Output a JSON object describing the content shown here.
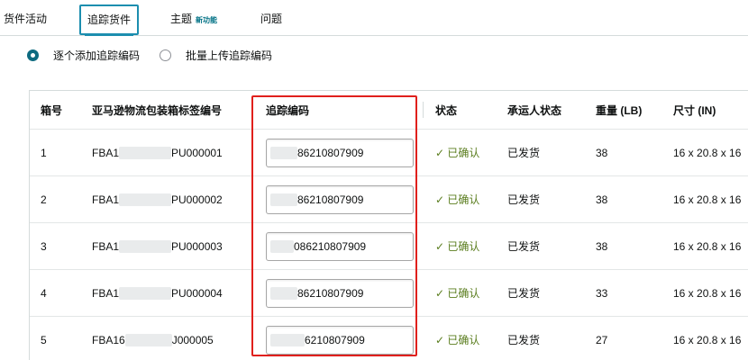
{
  "tabs": [
    {
      "label": "货件活动",
      "badge": ""
    },
    {
      "label": "追踪货件",
      "badge": ""
    },
    {
      "label": "主题",
      "badge": "新功能"
    },
    {
      "label": "问题",
      "badge": ""
    }
  ],
  "active_tab": "追踪货件",
  "upload_mode": {
    "options": [
      "逐个添加追踪编码",
      "批量上传追踪编码"
    ],
    "selected": "逐个添加追踪编码"
  },
  "table": {
    "headers": {
      "box": "箱号",
      "label": "亚马逊物流包装箱标签编号",
      "tracking": "追踪编码",
      "status": "状态",
      "carrier_status": "承运人状态",
      "weight": "重量 (LB)",
      "dims": "尺寸 (IN)"
    },
    "rows": [
      {
        "box": "1",
        "label_prefix": "FBA1",
        "label_suffix": "PU000001",
        "tracking": "86210807909",
        "status": "✓ 已确认",
        "carrier_status": "已发货",
        "weight": "38",
        "dims": "16 x 20.8 x 16"
      },
      {
        "box": "2",
        "label_prefix": "FBA1",
        "label_suffix": "PU000002",
        "tracking": "86210807909",
        "status": "✓ 已确认",
        "carrier_status": "已发货",
        "weight": "38",
        "dims": "16 x 20.8 x 16"
      },
      {
        "box": "3",
        "label_prefix": "FBA1",
        "label_suffix": "PU000003",
        "tracking": "086210807909",
        "status": "✓ 已确认",
        "carrier_status": "已发货",
        "weight": "38",
        "dims": "16 x 20.8 x 16"
      },
      {
        "box": "4",
        "label_prefix": "FBA1",
        "label_suffix": "PU000004",
        "tracking": "86210807909",
        "status": "✓ 已确认",
        "carrier_status": "已发货",
        "weight": "33",
        "dims": "16 x 20.8 x 16"
      },
      {
        "box": "5",
        "label_prefix": "FBA16",
        "label_suffix": "J000005",
        "tracking": "6210807909",
        "status": "✓ 已确认",
        "carrier_status": "已发货",
        "weight": "27",
        "dims": "16 x 20.8 x 16"
      }
    ]
  },
  "colors": {
    "accent": "#1c8eaf",
    "highlight": "#e0201c",
    "confirmed": "#5a7d1e"
  }
}
